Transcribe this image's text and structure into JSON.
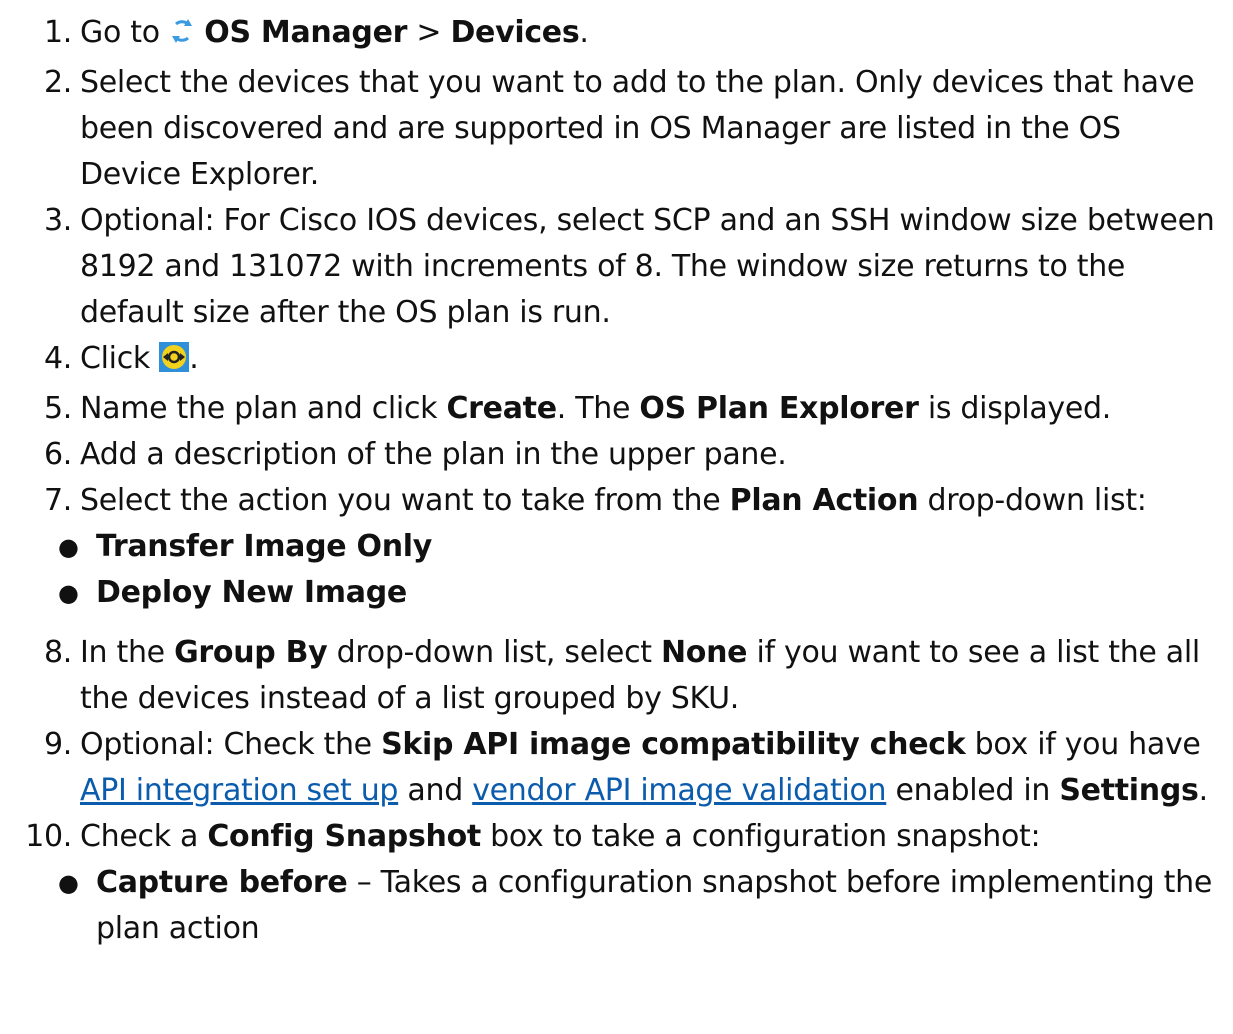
{
  "steps": [
    {
      "num": "1.",
      "pre": "Go to ",
      "icon": "refresh-arrows-icon",
      "b1": "OS Manager",
      "mid": " > ",
      "b2": "Devices",
      "post": "."
    },
    {
      "num": "2.",
      "text": "Select the devices that you want to add to the plan. Only devices that have been discovered and are supported in OS Manager are listed in the OS Device Explorer."
    },
    {
      "num": "3.",
      "text": "Optional: For Cisco IOS devices, select SCP and an SSH window size between 8192 and 131072 with increments of 8. The window size returns to the default size after the OS plan is run."
    },
    {
      "num": "4.",
      "pre": "Click ",
      "icon": "create-plan-icon",
      "post": "."
    },
    {
      "num": "5.",
      "pre": "Name the plan and click ",
      "b1": "Create",
      "mid": ". The ",
      "b2": "OS Plan Explorer",
      "post": " is displayed."
    },
    {
      "num": "6.",
      "text": "Add a description of the plan in the upper pane."
    },
    {
      "num": "7.",
      "pre": "Select the action you want to take from the ",
      "b1": "Plan Action",
      "post": " drop-down list:",
      "sub": [
        "Transfer Image Only",
        "Deploy New Image"
      ]
    },
    {
      "num": "8.",
      "pre": "In the ",
      "b1": "Group By",
      "mid": " drop-down list, select ",
      "b2": "None",
      "post": " if you want to see a list the all the devices instead of a list grouped by SKU."
    },
    {
      "num": "9.",
      "pre": "Optional: Check the ",
      "b1": "Skip API image compatibility check",
      "mid": " box if you have ",
      "link1": "API integration set up",
      "mid2": " and ",
      "link2": "vendor API image validation",
      "mid3": " enabled in ",
      "b2": "Settings",
      "post": "."
    },
    {
      "num": "10.",
      "pre": "Check a ",
      "b1": "Config Snapshot",
      "post": " box to take a configuration snapshot:",
      "sub2": {
        "b": "Capture before",
        "text": " – Takes a configuration snapshot before implementing the plan action"
      }
    }
  ],
  "colors": {
    "link": "#0b5cad",
    "icon_yellow": "#f2d21c",
    "icon_blue": "#2f8fd8"
  }
}
